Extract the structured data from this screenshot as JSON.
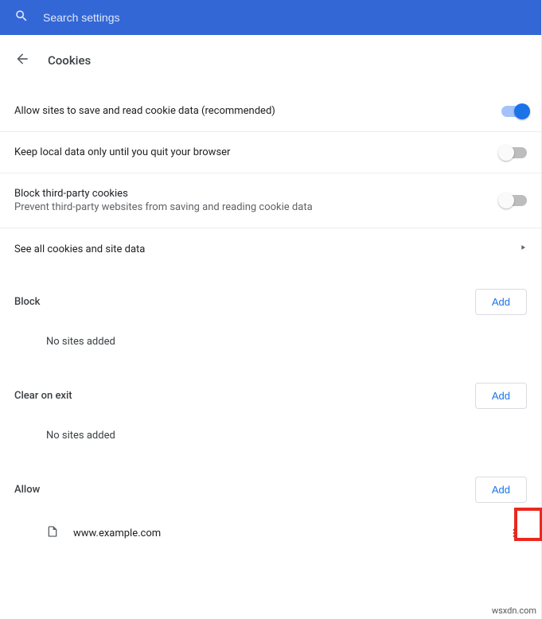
{
  "search": {
    "placeholder": "Search settings"
  },
  "header": {
    "title": "Cookies"
  },
  "settings": {
    "allow_cookies": {
      "label": "Allow sites to save and read cookie data (recommended)",
      "on": true
    },
    "keep_local": {
      "label": "Keep local data only until you quit your browser",
      "on": false
    },
    "block_third": {
      "label": "Block third-party cookies",
      "sub": "Prevent third-party websites from saving and reading cookie data",
      "on": false
    },
    "see_all": {
      "label": "See all cookies and site data"
    }
  },
  "sections": {
    "block": {
      "title": "Block",
      "add": "Add",
      "empty": "No sites added"
    },
    "clear": {
      "title": "Clear on exit",
      "add": "Add",
      "empty": "No sites added"
    },
    "allow": {
      "title": "Allow",
      "add": "Add",
      "sites": [
        {
          "name": "www.example.com"
        }
      ]
    }
  },
  "attribution": "wsxdn.com"
}
